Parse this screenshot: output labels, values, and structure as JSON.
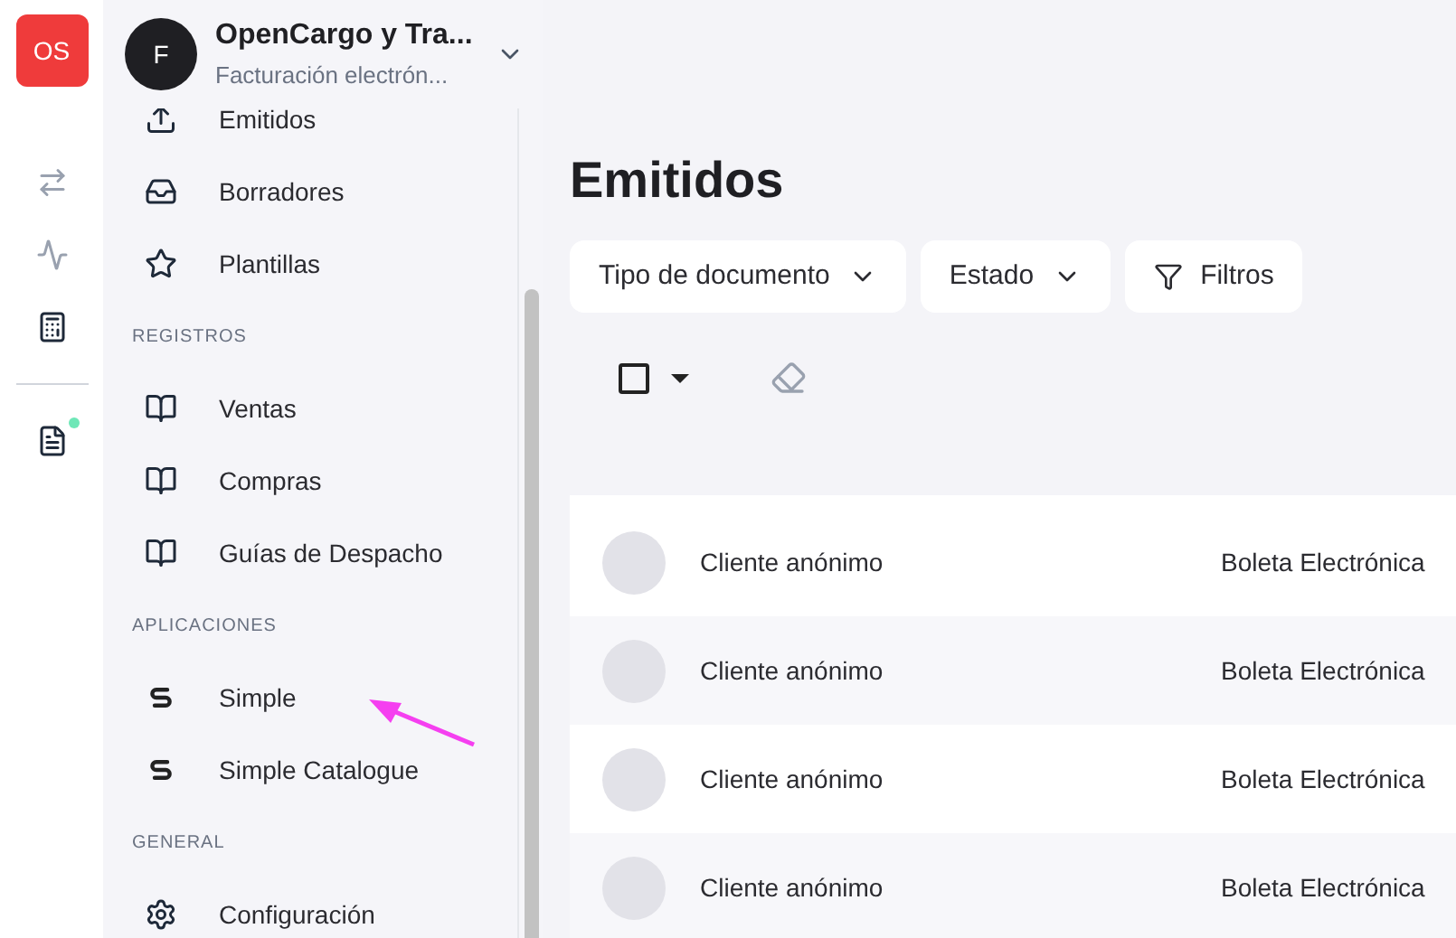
{
  "rail": {
    "logo": "OS",
    "items": [
      {
        "kind": "compress"
      },
      {
        "kind": "activity"
      },
      {
        "kind": "register"
      }
    ],
    "bottom_items": [
      {
        "kind": "document",
        "color": "#6ee7b7"
      }
    ]
  },
  "company": {
    "avatar": "F",
    "name": "OpenCargo y Tra...",
    "subtitle": "Facturación electrón..."
  },
  "sidebar": {
    "sections": [
      {
        "items": [
          {
            "label": "Emitidos",
            "kind": "upload"
          },
          {
            "label": "Borradores",
            "kind": "inbox"
          },
          {
            "label": "Plantillas",
            "kind": "star"
          }
        ]
      },
      {
        "title": "REGISTROS",
        "items": [
          {
            "label": "Ventas",
            "kind": "book"
          },
          {
            "label": "Compras",
            "kind": "book"
          },
          {
            "label": "Guías de Despacho",
            "kind": "book"
          }
        ]
      },
      {
        "title": "APLICACIONES",
        "items": [
          {
            "label": "Simple",
            "kind": "app"
          },
          {
            "label": "Simple Catalogue",
            "kind": "app"
          }
        ]
      },
      {
        "title": "GENERAL",
        "items": [
          {
            "label": "Configuración",
            "kind": "settings"
          }
        ]
      }
    ]
  },
  "main": {
    "title": "Emitidos",
    "filters": [
      {
        "label": "Tipo de documento",
        "kind": "dropdown"
      },
      {
        "label": "Estado",
        "kind": "dropdown"
      },
      {
        "label": "Filtros",
        "kind": "filter"
      }
    ],
    "select_all": {
      "checked": false
    },
    "rows": [
      {
        "name": "Cliente anónimo",
        "type": "Boleta Electrónica"
      },
      {
        "name": "Cliente anónimo",
        "type": "Boleta Electrónica"
      },
      {
        "name": "Cliente anónimo",
        "type": "Boleta Electrónica"
      },
      {
        "name": "Cliente anónimo",
        "type": "Boleta Electrónica"
      }
    ]
  }
}
